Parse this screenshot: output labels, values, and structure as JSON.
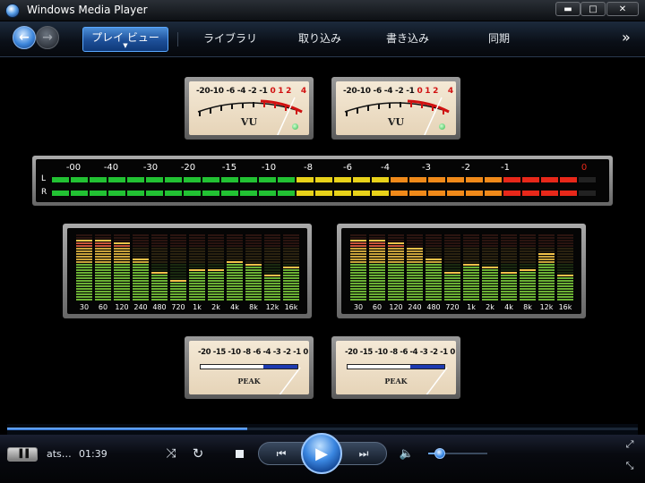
{
  "window": {
    "title": "Windows Media Player",
    "min_glyph": "▬",
    "max_glyph": "□",
    "close_glyph": "✕"
  },
  "nav": {
    "back_glyph": "←",
    "forward_glyph": "→",
    "tabs": [
      {
        "label": "プレイ ビュー",
        "caret": "▼"
      },
      {
        "label": "ライブラリ"
      },
      {
        "label": "取り込み"
      },
      {
        "label": "書き込み"
      },
      {
        "label": "同期"
      }
    ],
    "more_glyph": "»"
  },
  "visualization": {
    "vu_meters": [
      {
        "scale": "-20-10 -6 -4 -2 -1",
        "scale_red": "0 1 2",
        "scale_red_far": "4",
        "label": "VU"
      },
      {
        "scale": "-20-10 -6 -4 -2 -1",
        "scale_red": "0 1 2",
        "scale_red_far": "4",
        "label": "VU"
      }
    ],
    "led_bar": {
      "row_labels": [
        "L",
        "R"
      ],
      "ticks": [
        "-00",
        "-40",
        "-30",
        "-20",
        "-15",
        "-10",
        "-8",
        "-6",
        "-4",
        "-3",
        "-2",
        "-1",
        "0"
      ],
      "levels": [
        0.97,
        0.97
      ]
    },
    "spectrum": {
      "bands": [
        "30",
        "60",
        "120",
        "240",
        "480",
        "720",
        "1k",
        "2k",
        "4k",
        "8k",
        "12k",
        "16k"
      ],
      "left_levels": [
        0.92,
        0.92,
        0.86,
        0.62,
        0.45,
        0.33,
        0.47,
        0.49,
        0.59,
        0.58,
        0.38,
        0.53
      ],
      "right_levels": [
        0.92,
        0.92,
        0.86,
        0.78,
        0.62,
        0.43,
        0.58,
        0.52,
        0.43,
        0.47,
        0.7,
        0.38
      ]
    },
    "peak_meters": [
      {
        "scale": "-20 -15 -10 -8 -6  -4 -3 -2 -1  0",
        "label": "PEAK"
      },
      {
        "scale": "-20 -15 -10 -8 -6  -4 -3 -2 -1  0",
        "label": "PEAK"
      }
    ]
  },
  "player": {
    "seek_progress": 0.38,
    "view_glyph": "▐▐",
    "now_playing": "ats…",
    "time": "01:39",
    "shuffle_glyph": "⤨",
    "repeat_glyph": "↻",
    "prev_glyph": "⏮",
    "play_glyph": "▶",
    "next_glyph": "⏭",
    "mute_glyph": "🔈",
    "volume": 0.2,
    "fullscreen_glyph": "⤢",
    "compact_glyph": "⤡",
    "colors": {
      "accent": "#3a86e0",
      "led_green": "#22c233",
      "led_yellow": "#e8d21a",
      "led_red": "#e8281a"
    }
  }
}
